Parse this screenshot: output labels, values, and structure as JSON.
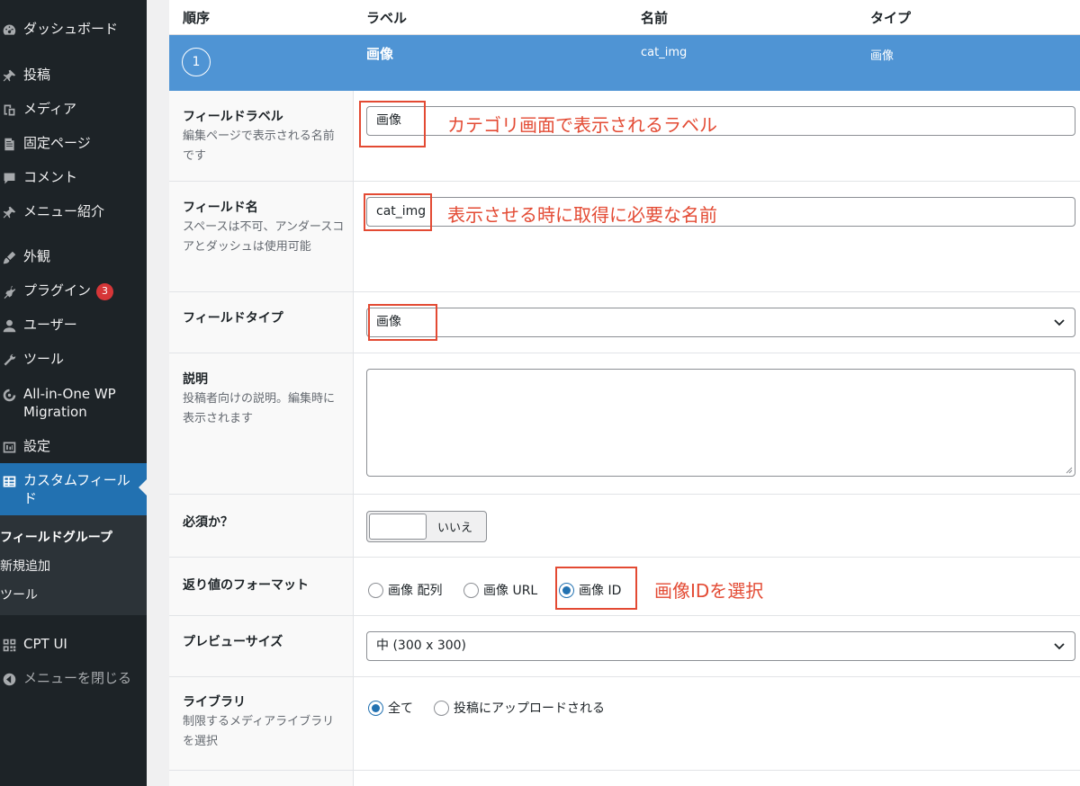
{
  "sidebar": {
    "items": [
      {
        "label": "ダッシュボード",
        "icon": "dashboard-icon"
      },
      {
        "label": "投稿",
        "icon": "pin-icon"
      },
      {
        "label": "メディア",
        "icon": "media-icon"
      },
      {
        "label": "固定ページ",
        "icon": "page-icon"
      },
      {
        "label": "コメント",
        "icon": "comment-icon"
      },
      {
        "label": "メニュー紹介",
        "icon": "pin-icon"
      },
      {
        "label": "外観",
        "icon": "brush-icon"
      },
      {
        "label": "プラグイン",
        "icon": "plugin-icon",
        "badge": "3"
      },
      {
        "label": "ユーザー",
        "icon": "user-icon"
      },
      {
        "label": "ツール",
        "icon": "wrench-icon"
      },
      {
        "label": "All-in-One WP Migration",
        "icon": "migration-icon"
      },
      {
        "label": "設定",
        "icon": "settings-icon"
      },
      {
        "label": "カスタムフィールド",
        "icon": "table-icon"
      },
      {
        "label": "CPT UI",
        "icon": "grid-icon"
      },
      {
        "label": "メニューを閉じる",
        "icon": "collapse-icon"
      }
    ],
    "submenu": [
      "フィールドグループ",
      "新規追加",
      "ツール"
    ]
  },
  "columns": {
    "order": "順序",
    "label": "ラベル",
    "name": "名前",
    "type": "タイプ"
  },
  "field_row": {
    "order": "1",
    "label": "画像",
    "name": "cat_img",
    "type": "画像"
  },
  "settings": {
    "field_label": {
      "title": "フィールドラベル",
      "desc": "編集ページで表示される名前です",
      "value": "画像"
    },
    "field_name": {
      "title": "フィールド名",
      "desc": "スペースは不可、アンダースコアとダッシュは使用可能",
      "value": "cat_img"
    },
    "field_type": {
      "title": "フィールドタイプ",
      "value": "画像"
    },
    "instructions": {
      "title": "説明",
      "desc": "投稿者向けの説明。編集時に表示されます"
    },
    "required": {
      "title": "必須か？",
      "toggle_label": "いいえ"
    },
    "return_format": {
      "title": "返り値のフォーマット",
      "options": [
        "画像 配列",
        "画像 URL",
        "画像 ID"
      ],
      "selected": "画像 ID"
    },
    "preview_size": {
      "title": "プレビューサイズ",
      "value": "中 (300 x 300)"
    },
    "library": {
      "title": "ライブラリ",
      "desc": "制限するメディアライブラリを選択",
      "options": [
        "全て",
        "投稿にアップロードされる"
      ],
      "selected": "全て"
    }
  },
  "annotations": {
    "label_note": "カテゴリ画面で表示されるラベル",
    "name_note": "表示させる時に取得に必要な名前",
    "format_note": "画像IDを選択"
  },
  "colors": {
    "accent": "#2271b1",
    "annotation": "#e34a33",
    "row_highlight": "#4f94d4"
  }
}
